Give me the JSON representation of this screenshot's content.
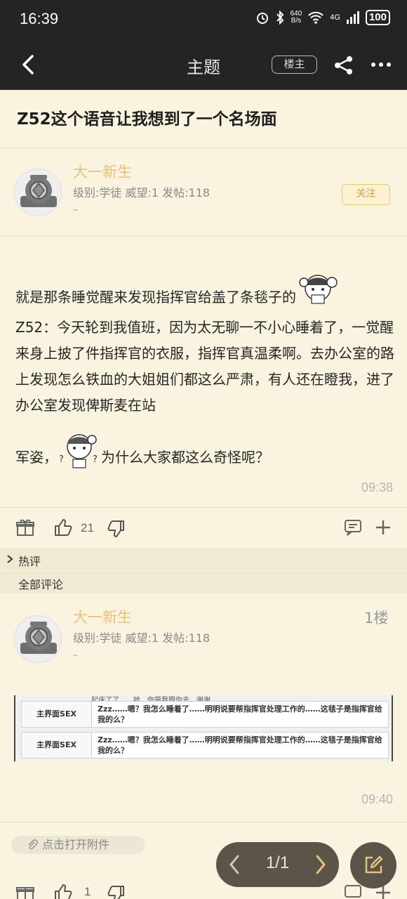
{
  "status": {
    "time": "16:39",
    "speed_top": "640",
    "speed_bottom": "B/s",
    "network": "4G",
    "battery": "100"
  },
  "header": {
    "title": "主题",
    "owner_label": "楼主"
  },
  "thread": {
    "title": "Z52这个语音让我想到了一个名场面"
  },
  "op": {
    "username": "大一新生",
    "meta": "级别:学徒 威望:1 发帖:118",
    "dash": "–",
    "follow_label": "关注",
    "body_line1": "就是那条睡觉醒来发现指挥官给盖了条毯子的",
    "body_middle": "Z52：今天轮到我值班，因为太无聊一不小心睡着了，一觉醒来身上披了件指挥官的衣服，指挥官真温柔啊。去办公室的路上发现怎么铁血的大姐姐们都这么严肃，有人还在瞪我，进了办公室发现俾斯麦在站",
    "body_end_a": "军姿，",
    "body_end_b": "为什么大家都这么奇怪呢？",
    "time": "09:38",
    "likes": "21"
  },
  "sections": {
    "hot": "热评",
    "all": "全部评论"
  },
  "reply": {
    "username": "大一新生",
    "meta": "级别:学徒 威望:1 发帖:118",
    "dash": "–",
    "floor": "1楼",
    "screenshot": {
      "rows": [
        {
          "label": "主界面SEX",
          "text": "Zzz……嗯？我怎么睡着了……明明说要帮指挥官处理工作的……这毯子是指挥官给我的么？"
        },
        {
          "label": "主界面SEX",
          "text": "Zzz……嗯？我怎么睡着了……明明说要帮指挥官处理工作的……这毯子是指挥官给我的么？"
        }
      ],
      "cut_text": "起床了了……哈，你带我跟你去，谢谢……"
    },
    "time": "09:40",
    "likes": "1"
  },
  "attachment": {
    "label": "点击打开附件"
  },
  "pager": {
    "text": "1/1"
  },
  "colors": {
    "accent": "#e8c27a",
    "background": "#f9f3df",
    "topbar": "#242424"
  }
}
